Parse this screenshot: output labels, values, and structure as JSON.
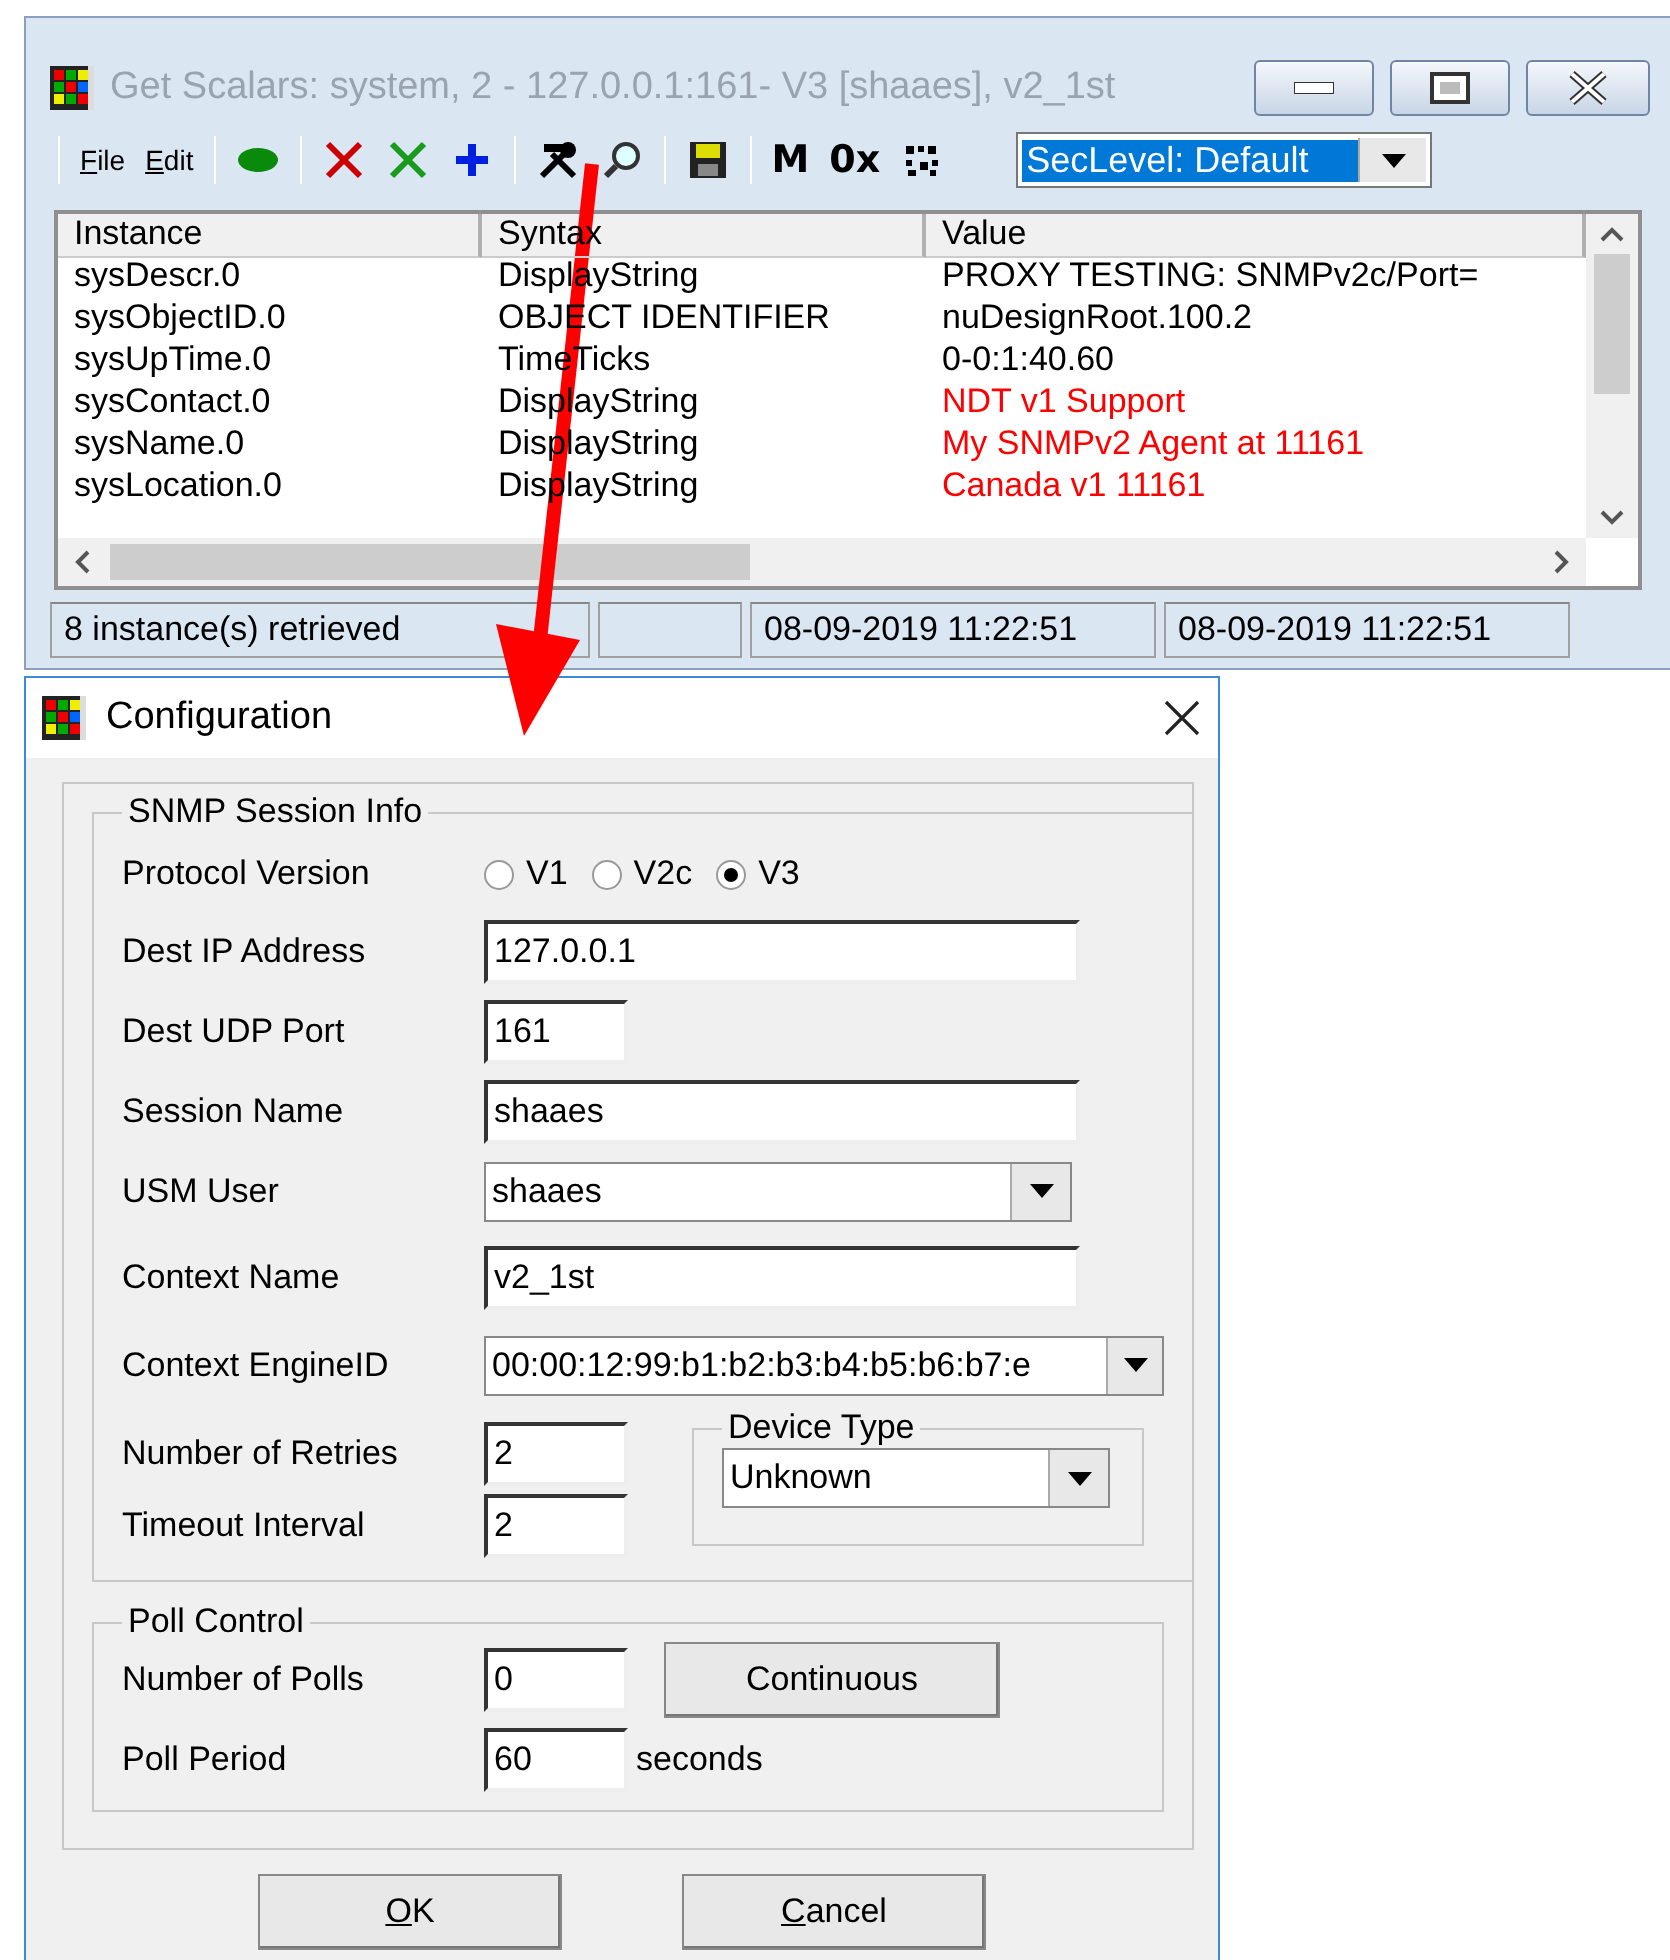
{
  "main_window": {
    "title": "Get Scalars: system, 2 - 127.0.0.1:161- V3 [shaaes], v2_1st",
    "toolbar": {
      "menus": [
        "File",
        "Edit"
      ],
      "glyph_buttons": [
        "M",
        "0x"
      ],
      "security_level": {
        "value": "SecLevel: Default",
        "selected": true
      }
    },
    "table": {
      "columns": [
        "Instance",
        "Syntax",
        "Value"
      ],
      "rows": [
        {
          "instance": "sysDescr.0",
          "syntax": "DisplayString",
          "value": "PROXY TESTING: SNMPv2c/Port=",
          "color": "#000000"
        },
        {
          "instance": "sysObjectID.0",
          "syntax": "OBJECT IDENTIFIER",
          "value": "nuDesignRoot.100.2",
          "color": "#000000"
        },
        {
          "instance": "sysUpTime.0",
          "syntax": "TimeTicks",
          "value": "0-0:1:40.60",
          "color": "#000000"
        },
        {
          "instance": "sysContact.0",
          "syntax": "DisplayString",
          "value": "NDT v1 Support",
          "color": "#ff0000"
        },
        {
          "instance": "sysName.0",
          "syntax": "DisplayString",
          "value": "My SNMPv2 Agent at 11161",
          "color": "#ff0000"
        },
        {
          "instance": "sysLocation.0",
          "syntax": "DisplayString",
          "value": "Canada v1 11161",
          "color": "#ff0000"
        }
      ]
    },
    "status_bar": [
      "8 instance(s) retrieved",
      "08-09-2019 11:22:51",
      "08-09-2019 11:22:51"
    ]
  },
  "dialog": {
    "title": "Configuration",
    "session_group": {
      "title": "SNMP Session Info",
      "protocol": {
        "label": "Protocol Version",
        "options": [
          {
            "label": "V1",
            "selected": false
          },
          {
            "label": "V2c",
            "selected": false
          },
          {
            "label": "V3",
            "selected": true
          }
        ]
      },
      "fields": [
        {
          "kind": "text",
          "label": "Dest IP Address",
          "value": "127.0.0.1"
        },
        {
          "kind": "short",
          "label": "Dest UDP Port",
          "value": "161"
        },
        {
          "kind": "text",
          "label": "Session Name",
          "value": "shaaes"
        },
        {
          "kind": "select",
          "label": "USM User",
          "value": "shaaes"
        },
        {
          "kind": "text",
          "label": "Context Name",
          "value": "v2_1st"
        },
        {
          "kind": "wideselect",
          "label": "Context EngineID",
          "value": "00:00:12:99:b1:b2:b3:b4:b5:b6:b7:e"
        }
      ],
      "retries": {
        "label": "Number of Retries",
        "value": "2"
      },
      "timeout": {
        "label": "Timeout Interval",
        "value": "2"
      },
      "device_type": {
        "title": "Device Type",
        "value": "Unknown"
      }
    },
    "poll_group": {
      "title": "Poll Control",
      "polls": {
        "label": "Number of Polls",
        "value": "0"
      },
      "continuous_button": "Continuous",
      "period": {
        "label": "Poll Period",
        "value": "60",
        "unit": "seconds"
      }
    },
    "buttons": [
      "OK",
      "Cancel"
    ]
  }
}
